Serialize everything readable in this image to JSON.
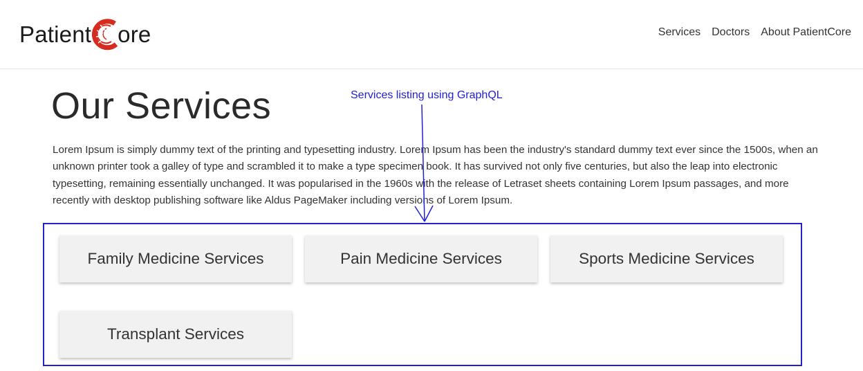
{
  "brand": {
    "name_prefix": "Patient",
    "name_suffix": "ore",
    "accent_color": "#d62b1f"
  },
  "nav": {
    "items": [
      {
        "label": "Services"
      },
      {
        "label": "Doctors"
      },
      {
        "label": "About PatientCore"
      }
    ]
  },
  "main": {
    "title": "Our Services",
    "intro": "Lorem Ipsum is simply dummy text of the printing and typesetting industry. Lorem Ipsum has been the industry's standard dummy text ever since the 1500s, when an unknown printer took a galley of type and scrambled it to make a type specimen book. It has survived not only five centuries, but also the leap into electronic typesetting, remaining essentially unchanged. It was popularised in the 1960s with the release of Letraset sheets containing Lorem Ipsum passages, and more recently with desktop publishing software like Aldus PageMaker including versions of Lorem Ipsum.",
    "services": [
      {
        "label": "Family Medicine Services"
      },
      {
        "label": "Pain Medicine Services"
      },
      {
        "label": "Sports Medicine Services"
      },
      {
        "label": "Transplant Services"
      }
    ]
  },
  "annotation": {
    "label": "Services listing using GraphQL",
    "color": "#2020d8"
  }
}
